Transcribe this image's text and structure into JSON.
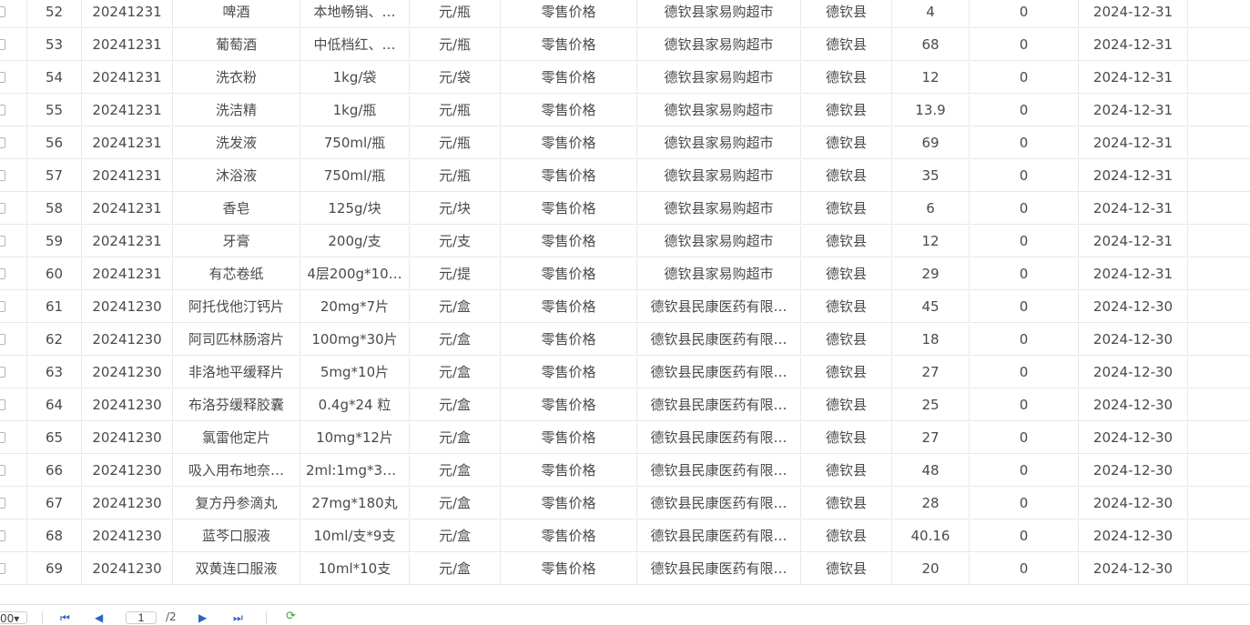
{
  "columns_x": [
    0,
    30,
    90,
    190,
    330,
    450,
    550,
    700,
    880,
    980,
    1065,
    1185,
    1305
  ],
  "rows": [
    {
      "no": "52",
      "date": "20241231",
      "name": "啤酒",
      "spec": "本地畅销、…",
      "unit": "元/瓶",
      "type": "零售价格",
      "store": "德钦县家易购超市",
      "county": "德钦县",
      "price": "4",
      "change": "0",
      "day": "2024-12-31"
    },
    {
      "no": "53",
      "date": "20241231",
      "name": "葡萄酒",
      "spec": "中低档红、…",
      "unit": "元/瓶",
      "type": "零售价格",
      "store": "德钦县家易购超市",
      "county": "德钦县",
      "price": "68",
      "change": "0",
      "day": "2024-12-31"
    },
    {
      "no": "54",
      "date": "20241231",
      "name": "洗衣粉",
      "spec": "1kg/袋",
      "unit": "元/袋",
      "type": "零售价格",
      "store": "德钦县家易购超市",
      "county": "德钦县",
      "price": "12",
      "change": "0",
      "day": "2024-12-31"
    },
    {
      "no": "55",
      "date": "20241231",
      "name": "洗洁精",
      "spec": "1kg/瓶",
      "unit": "元/瓶",
      "type": "零售价格",
      "store": "德钦县家易购超市",
      "county": "德钦县",
      "price": "13.9",
      "change": "0",
      "day": "2024-12-31"
    },
    {
      "no": "56",
      "date": "20241231",
      "name": "洗发液",
      "spec": "750ml/瓶",
      "unit": "元/瓶",
      "type": "零售价格",
      "store": "德钦县家易购超市",
      "county": "德钦县",
      "price": "69",
      "change": "0",
      "day": "2024-12-31"
    },
    {
      "no": "57",
      "date": "20241231",
      "name": "沐浴液",
      "spec": "750ml/瓶",
      "unit": "元/瓶",
      "type": "零售价格",
      "store": "德钦县家易购超市",
      "county": "德钦县",
      "price": "35",
      "change": "0",
      "day": "2024-12-31"
    },
    {
      "no": "58",
      "date": "20241231",
      "name": "香皂",
      "spec": "125g/块",
      "unit": "元/块",
      "type": "零售价格",
      "store": "德钦县家易购超市",
      "county": "德钦县",
      "price": "6",
      "change": "0",
      "day": "2024-12-31"
    },
    {
      "no": "59",
      "date": "20241231",
      "name": "牙膏",
      "spec": "200g/支",
      "unit": "元/支",
      "type": "零售价格",
      "store": "德钦县家易购超市",
      "county": "德钦县",
      "price": "12",
      "change": "0",
      "day": "2024-12-31"
    },
    {
      "no": "60",
      "date": "20241231",
      "name": "有芯卷纸",
      "spec": "4层200g*10…",
      "unit": "元/提",
      "type": "零售价格",
      "store": "德钦县家易购超市",
      "county": "德钦县",
      "price": "29",
      "change": "0",
      "day": "2024-12-31"
    },
    {
      "no": "61",
      "date": "20241230",
      "name": "阿托伐他汀钙片",
      "spec": "20mg*7片",
      "unit": "元/盒",
      "type": "零售价格",
      "store": "德钦县民康医药有限…",
      "county": "德钦县",
      "price": "45",
      "change": "0",
      "day": "2024-12-30"
    },
    {
      "no": "62",
      "date": "20241230",
      "name": "阿司匹林肠溶片",
      "spec": "100mg*30片",
      "unit": "元/盒",
      "type": "零售价格",
      "store": "德钦县民康医药有限…",
      "county": "德钦县",
      "price": "18",
      "change": "0",
      "day": "2024-12-30"
    },
    {
      "no": "63",
      "date": "20241230",
      "name": "非洛地平缓释片",
      "spec": "5mg*10片",
      "unit": "元/盒",
      "type": "零售价格",
      "store": "德钦县民康医药有限…",
      "county": "德钦县",
      "price": "27",
      "change": "0",
      "day": "2024-12-30"
    },
    {
      "no": "64",
      "date": "20241230",
      "name": "布洛芬缓释胶囊",
      "spec": "0.4g*24 粒",
      "unit": "元/盒",
      "type": "零售价格",
      "store": "德钦县民康医药有限…",
      "county": "德钦县",
      "price": "25",
      "change": "0",
      "day": "2024-12-30"
    },
    {
      "no": "65",
      "date": "20241230",
      "name": "氯雷他定片",
      "spec": "10mg*12片",
      "unit": "元/盒",
      "type": "零售价格",
      "store": "德钦县民康医药有限…",
      "county": "德钦县",
      "price": "27",
      "change": "0",
      "day": "2024-12-30"
    },
    {
      "no": "66",
      "date": "20241230",
      "name": "吸入用布地奈…",
      "spec": "2ml:1mg*30…",
      "unit": "元/盒",
      "type": "零售价格",
      "store": "德钦县民康医药有限…",
      "county": "德钦县",
      "price": "48",
      "change": "0",
      "day": "2024-12-30"
    },
    {
      "no": "67",
      "date": "20241230",
      "name": "复方丹参滴丸",
      "spec": "27mg*180丸",
      "unit": "元/盒",
      "type": "零售价格",
      "store": "德钦县民康医药有限…",
      "county": "德钦县",
      "price": "28",
      "change": "0",
      "day": "2024-12-30"
    },
    {
      "no": "68",
      "date": "20241230",
      "name": "蓝芩口服液",
      "spec": "10ml/支*9支",
      "unit": "元/盒",
      "type": "零售价格",
      "store": "德钦县民康医药有限…",
      "county": "德钦县",
      "price": "40.16",
      "change": "0",
      "day": "2024-12-30"
    },
    {
      "no": "69",
      "date": "20241230",
      "name": "双黄连口服液",
      "spec": "10ml*10支",
      "unit": "元/盒",
      "type": "零售价格",
      "store": "德钦县民康医药有限…",
      "county": "德钦县",
      "price": "20",
      "change": "0",
      "day": "2024-12-30"
    }
  ],
  "pager": {
    "page_size": "00",
    "current_page": "1",
    "total_pages": "/2"
  },
  "icons": {
    "first": "first-page-icon",
    "prev": "prev-page-icon",
    "next": "next-page-icon",
    "last": "last-page-icon",
    "refresh": "refresh-icon"
  },
  "colors": {
    "border": "#e8e8e8",
    "text": "#4a4a4a",
    "pager_icon": "#2d64c8",
    "refresh": "#3ca03c"
  }
}
